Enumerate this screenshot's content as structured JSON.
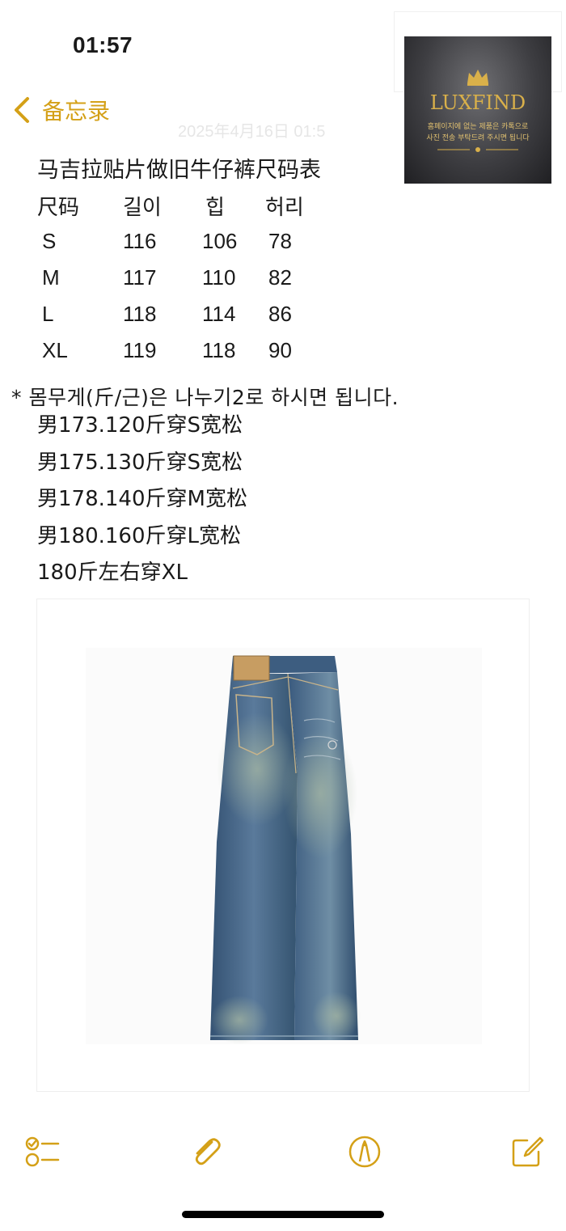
{
  "status_bar": {
    "time": "01:57"
  },
  "nav": {
    "back_label": "备忘录"
  },
  "faint_date": "2025年4月16日 01:5",
  "logo": {
    "brand": "LUXFIND",
    "line1": "홈페이지에 없는 제품은 카톡으로",
    "line2": "사진 전송 부탁드려 주시면 됩니다",
    "colors": {
      "gold": "#d9b04a",
      "background": "#3e3e42"
    }
  },
  "note": {
    "title": "马吉拉贴片做旧牛仔裤尺码表",
    "table": {
      "headers": [
        "尺码",
        "길이",
        "힙",
        "허리"
      ],
      "rows": [
        [
          "S",
          "116",
          "106",
          "78"
        ],
        [
          "M",
          "117",
          "110",
          "82"
        ],
        [
          "L",
          "118",
          "114",
          "86"
        ],
        [
          "XL",
          "119",
          "118",
          "90"
        ]
      ]
    },
    "korean_note": "* 몸무게(斤/근)은 나누기2로 하시면 됩니다.",
    "weight_guide": [
      "男173.120斤穿S宽松",
      "男175.130斤穿S宽松",
      "男178.140斤穿M宽松",
      "男180.160斤穿L宽松",
      "180斤左右穿XL"
    ]
  },
  "product_image": {
    "subject": "jeans-photo",
    "colors": {
      "denim": "#3f6186",
      "denim_light": "#8aa3b6",
      "patch": "#c79d62"
    }
  },
  "toolbar": {
    "icons": [
      "checklist-icon",
      "paperclip-icon",
      "markup-pen-icon",
      "compose-icon"
    ],
    "accent": "#d4a017"
  }
}
